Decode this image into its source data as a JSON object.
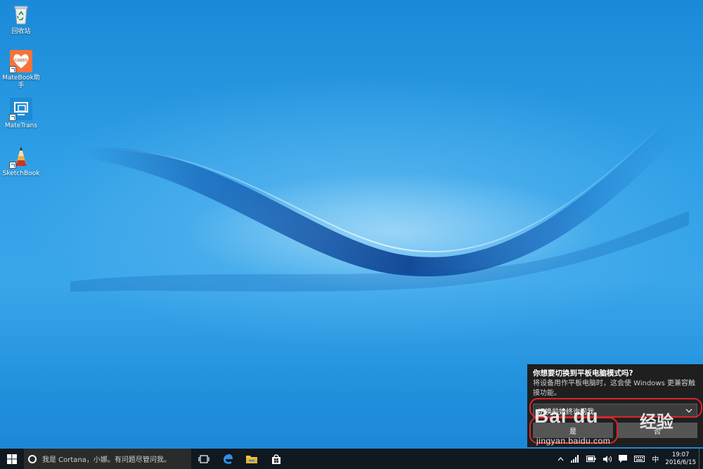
{
  "desktop_icons": [
    {
      "label": "回收站",
      "icon": "recycle-bin-icon"
    },
    {
      "label": "MateBook助手",
      "badge": "CARES",
      "icon": "matebook-icon"
    },
    {
      "label": "MateTrans",
      "icon": "matetrans-icon"
    },
    {
      "label": "SketchBook",
      "icon": "sketchbook-icon"
    }
  ],
  "taskbar": {
    "search_placeholder": "我是 Cortana，小娜。有问题尽管问我。",
    "apps": [
      "task-view-icon",
      "edge-icon",
      "file-explorer-icon",
      "store-icon"
    ],
    "tray": {
      "ime": "中",
      "time": "19:07",
      "date": "2016/6/15"
    }
  },
  "popup": {
    "title": "你想要切换到平板电脑模式吗?",
    "description": "将设备用作平板电脑时，这会使 Windows 更兼容触摸功能。",
    "select_value": "切换前始终询问我",
    "button_yes": "是",
    "button_no": "否"
  },
  "watermark": {
    "logo": "Bai du",
    "cn": "经验",
    "url": "jingyan.baidu.com"
  }
}
